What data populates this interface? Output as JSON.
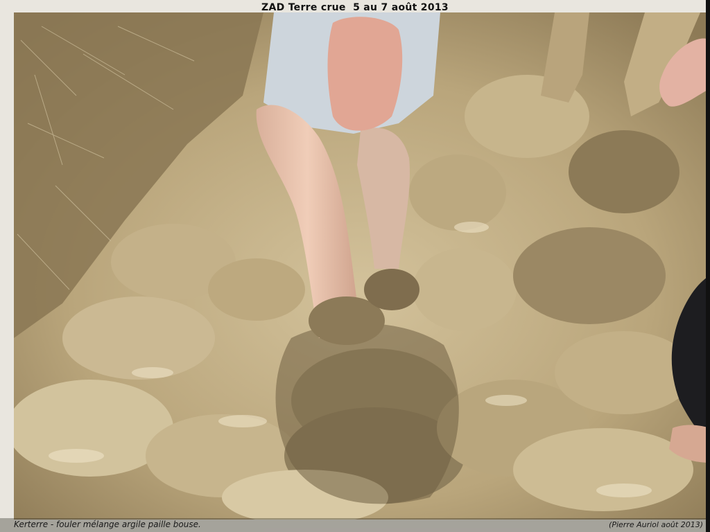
{
  "title": "ZAD Terre crue  5 au 7 août 2013",
  "caption": "Kerterre - fouler mélange argile paille bouse.",
  "credit": "(Pierre Auriol août 2013)",
  "colors": {
    "mud_light": "#cdbb92",
    "mud_mid": "#a8946b",
    "mud_dark": "#6f5e42",
    "skin": "#e6c2ad",
    "shorts": "#cdd5dc"
  }
}
